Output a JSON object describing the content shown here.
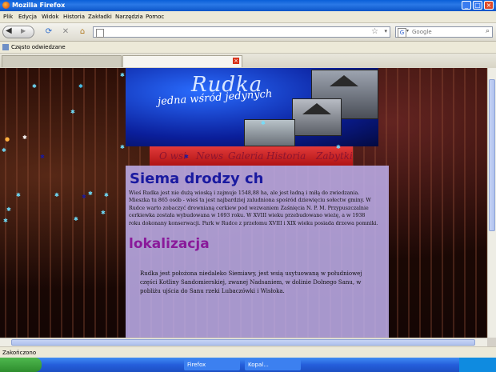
{
  "window": {
    "title": "Mozilla Firefox",
    "minimize": "_",
    "maximize": "□",
    "close": "×"
  },
  "menu": [
    "Plik",
    "Edycja",
    "Widok",
    "Historia",
    "Zakładki",
    "Narzędzia",
    "Pomoc"
  ],
  "nav": {
    "reload": "⟳",
    "stop": "✕",
    "home": "⌂",
    "url_value": "",
    "search_placeholder": "Google",
    "search_engine": "G"
  },
  "bookmarks": {
    "item": "Często odwiedzane"
  },
  "tabs": [
    {
      "title": ""
    },
    {
      "title": ""
    }
  ],
  "page": {
    "banner_title": "Rudka",
    "banner_subtitle": "jedna wśród jedynych",
    "nav_items": [
      "O wsi",
      "News",
      "Galeria",
      "Historia",
      "Zabytki"
    ],
    "heading1": "Siema drodzy ch",
    "paragraph1": "Wieś Rudka jest nie dużą wioską i zajmuje 1548,88 ha, ale jest ładną i miłą do zwiedzania. Mieszka tu 865 osób - wieś ta jest najbardziej zaludniona spośród dziewięciu sołectw gminy. W Rudce warto zobaczyć drewnianą cerkiew pod wezwaniem Zaśnięcia N. P. M. Przypuszczalnie cerkiewka została wybudowana w 1693 roku. W XVIII wieku przebudowano wieżę, a w 1938 roku dokonany konserwacji. Park w Rudce z przełomu XVIII i XIX wieku posiada drzewa pomniki.",
    "heading2": "lokalizacja",
    "paragraph2": "Rudka jest położona niedaleko Siemiawy, jest wsią usytuowaną w południowej części Kotliny Sandomierskiej, zwanej Nadsaniem, w dolinie Dolnego Sanu, w pobliżu ujścia do Sanu rzeki Lubaczówki i Wisłoka."
  },
  "status": {
    "text": "Zakończono"
  },
  "taskbar": {
    "items": [
      "Firefox",
      "Kopal..."
    ]
  },
  "colors": {
    "heading1": "#1a1aa0",
    "heading2": "#8a1a9a",
    "nav_strip": "#c41e1e",
    "panel": "#bcace8"
  }
}
